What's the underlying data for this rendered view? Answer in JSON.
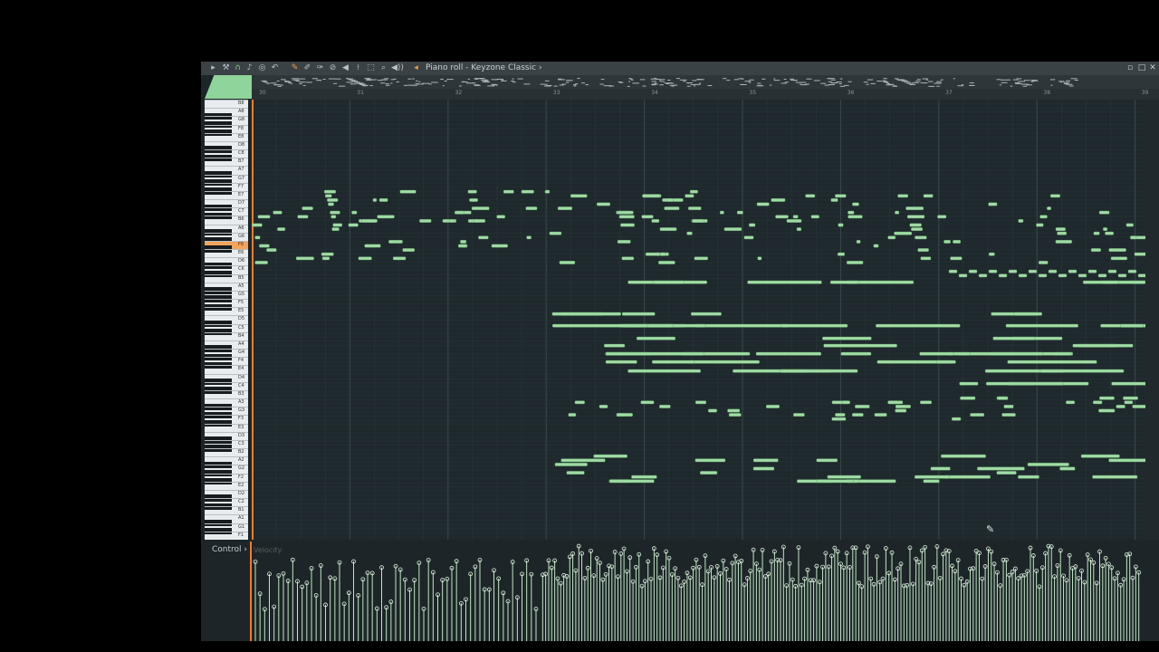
{
  "window": {
    "title": "Piano roll - Keyzone Classic",
    "title_arrow": "›",
    "controls": [
      "▫",
      "□",
      "✕"
    ]
  },
  "toolbar": {
    "icons": [
      "play-arrow-icon",
      "wrench-icon",
      "magnet-icon",
      "note-icon",
      "target-icon",
      "undo-icon",
      "pencil-icon",
      "paint-icon",
      "draw-icon",
      "delete-icon",
      "mute-icon",
      "slice-icon",
      "select-icon",
      "zoom-icon",
      "speaker-icon"
    ]
  },
  "ruler": {
    "bars": [
      "30",
      "31",
      "32",
      "33",
      "34",
      "35",
      "36",
      "37",
      "38",
      "39"
    ]
  },
  "keyboard": {
    "labels": [
      "B8",
      "A8",
      "G8",
      "F8",
      "E8",
      "D8",
      "C8",
      "B7",
      "A7",
      "G7",
      "F7",
      "E7",
      "D7",
      "C7",
      "B6",
      "A6",
      "G6",
      "F6",
      "E6",
      "D6",
      "C6",
      "B5",
      "A5",
      "G5",
      "F5",
      "E5",
      "D5",
      "C5",
      "B4",
      "A4",
      "G4",
      "F4",
      "E4",
      "D4",
      "C4",
      "B3",
      "A3",
      "G3",
      "F3",
      "E3",
      "D3",
      "C3",
      "B2",
      "A2",
      "G2",
      "F2",
      "E2",
      "D2",
      "C2",
      "B1",
      "A1",
      "G1",
      "F1"
    ],
    "highlighted": "F6"
  },
  "control_panel": {
    "label": "Control",
    "arrow": "›",
    "parameter": "Velocity"
  },
  "colors": {
    "note": "#9fdca4",
    "note_border": "#5e9a66",
    "accent": "#ff7a2a",
    "grid_bg": "#1f292d"
  }
}
